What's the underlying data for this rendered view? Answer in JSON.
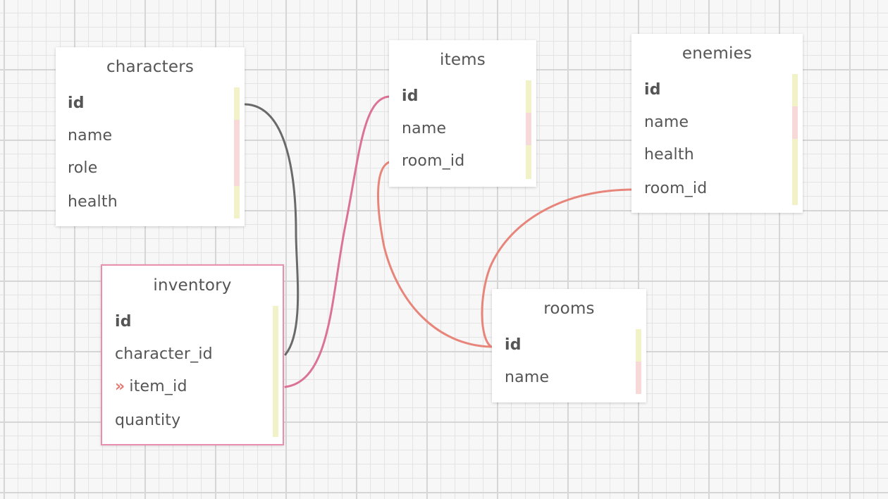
{
  "colors": {
    "connector_dark": "#6a6a6a",
    "connector_pink": "#db7397",
    "connector_salmon": "#e8857a",
    "selected_border": "#e88fb0",
    "strip_yellow": "#f2f2c9",
    "strip_pink": "#f8d9d9"
  },
  "tables": {
    "characters": {
      "title": "characters",
      "fields": [
        "id",
        "name",
        "role",
        "health"
      ]
    },
    "items": {
      "title": "items",
      "fields": [
        "id",
        "name",
        "room_id"
      ]
    },
    "enemies": {
      "title": "enemies",
      "fields": [
        "id",
        "name",
        "health",
        "room_id"
      ]
    },
    "inventory": {
      "title": "inventory",
      "selected": true,
      "fk_marker": "»",
      "fields": [
        "id",
        "character_id",
        "item_id",
        "quantity"
      ]
    },
    "rooms": {
      "title": "rooms",
      "fields": [
        "id",
        "name"
      ]
    }
  },
  "relationships": [
    {
      "from": "inventory.character_id",
      "to": "characters.id",
      "color": "dark"
    },
    {
      "from": "inventory.item_id",
      "to": "items.id",
      "color": "pink"
    },
    {
      "from": "items.room_id",
      "to": "rooms.id",
      "color": "salmon"
    },
    {
      "from": "enemies.room_id",
      "to": "rooms.id",
      "color": "salmon"
    }
  ]
}
